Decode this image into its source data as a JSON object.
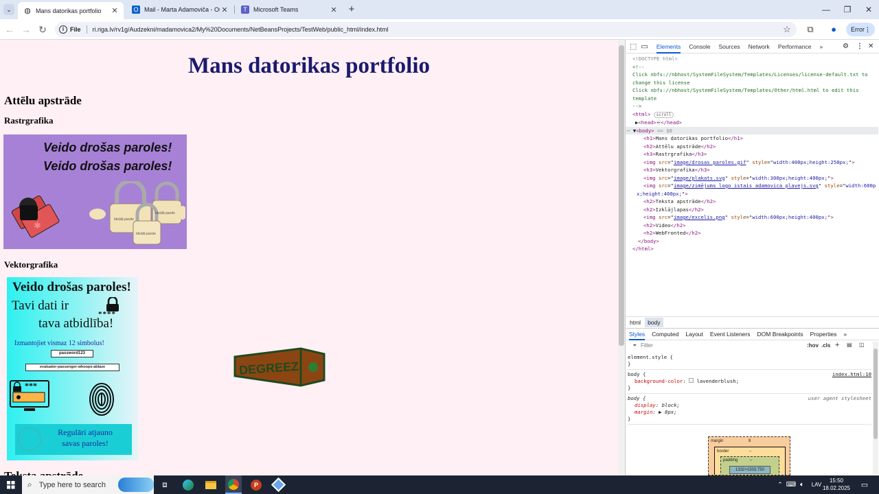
{
  "browser": {
    "tabs": [
      {
        "label": "Mans datorikas portfolio",
        "icon": "globe-icon",
        "active": true
      },
      {
        "label": "Mail - Marta Adamoviča - Outl",
        "icon": "outlook-icon",
        "active": false
      },
      {
        "label": "Microsoft Teams",
        "icon": "teams-icon",
        "active": false
      }
    ],
    "new_tab": "+",
    "address": {
      "scheme_label": "File",
      "url": "ri.riga.lv/rv1g/Audzekni/madamovica2/My%20Documents/NetBeansProjects/TestWeb/public_html/index.html"
    },
    "profile_status": "Error"
  },
  "page": {
    "title": "Mans datorikas portfolio",
    "section_image": "Attēlu apstrāde",
    "raster_heading": "Rastrgrafika",
    "vector_heading": "Vektorgrafika",
    "next_heading_partial": "Teksta apstrāde",
    "poster1": {
      "line1": "Veido drošas paroles!",
      "line2": "Veido drošas paroles!",
      "lock_label": "Ideālā parole"
    },
    "poster2": {
      "heading": "Veido drošas paroles!",
      "sub1": "Tavi dati ir",
      "sub2": "tava atbidlība!",
      "stars": "****",
      "tip": "Izmantojiet vismaz 12 simbolus!",
      "pw1": "password123",
      "pw2": "evaluator-passenger-whoops-ablaze",
      "screen_stars": "***",
      "footer1": "Regulāri atjauno",
      "footer2": "savas paroles!"
    },
    "logo_text": "DEGREEZ"
  },
  "devtools": {
    "tabs": [
      "Elements",
      "Console",
      "Sources",
      "Network",
      "Performance",
      "»"
    ],
    "active_tab": "Elements",
    "source": {
      "doctype": "<!DOCTYPE html>",
      "comment_open": "<!--",
      "comment1": "Click nbfs://nbhost/SystemFileSystem/Templates/Licenses/license-default.txt to",
      "comment2": "change this license",
      "comment3": "Click nbfs://nbhost/SystemFileSystem/Templates/Other/html.html to edit this",
      "comment4": "template",
      "comment_close": "-->",
      "html_open": "<html>",
      "scroll_badge": "scroll",
      "head": "<head>",
      "head_ellipsis": "⋯",
      "head_close": "</head>",
      "body_open": "<body>",
      "body_marker": "== $0",
      "h1": "Mans datorikas portfolio",
      "h2_a": "Attēlu apstrāde",
      "h3_a": "Rastrgrafika",
      "img1_src": "image/drosas_paroles.gif",
      "img1_style": "width:400px;height:250px;",
      "h3_b": "Vektorgrafika",
      "img2_src": "image/plakats.svg",
      "img2_style": "width:300px;height:400px;",
      "img3_src": "image/zimējums_logo_istais_adamovica_plavejs.svg",
      "img3_style_a": "width:600p",
      "img3_style_b": "x;height:400px;",
      "h2_b": "Teksta apstrāde",
      "h2_c": "Izklājlapas",
      "img4_src": "image/excelis.png",
      "img4_style": "width:600px;height:400px;",
      "h2_d": "Video",
      "h2_e": "WebFronted",
      "body_close": "</body>",
      "html_close": "</html>"
    },
    "breadcrumbs": [
      "html",
      "body"
    ],
    "style_tabs": [
      "Styles",
      "Computed",
      "Layout",
      "Event Listeners",
      "DOM Breakpoints",
      "Properties",
      "»"
    ],
    "filter_placeholder": "Filter",
    "filter_tools": [
      ":hov",
      ".cls",
      "+"
    ],
    "rules": [
      {
        "selector": "element.style {",
        "props": [],
        "source": ""
      },
      {
        "selector": "body {",
        "props": [
          {
            "name": "background-color",
            "value": "lavenderblush;"
          }
        ],
        "source": "index.html:10"
      },
      {
        "selector": "body {",
        "props": [
          {
            "name": "display",
            "value": "block;"
          },
          {
            "name": "margin",
            "value": "▶ 8px;"
          }
        ],
        "source": "user agent stylesheet"
      }
    ],
    "boxmodel": {
      "margin_label": "margin",
      "margin": "8",
      "border_label": "border",
      "border": "–",
      "padding_label": "padding",
      "padding": "–",
      "content": "1332×1503.750"
    }
  },
  "taskbar": {
    "search_placeholder": "Type here to search",
    "language": "LAV",
    "time": "15:50",
    "date": "18.02.2025"
  },
  "colors": {
    "page_bg": "#fff0f5",
    "title": "#1b1a6e",
    "accent": "#0b57d0"
  }
}
